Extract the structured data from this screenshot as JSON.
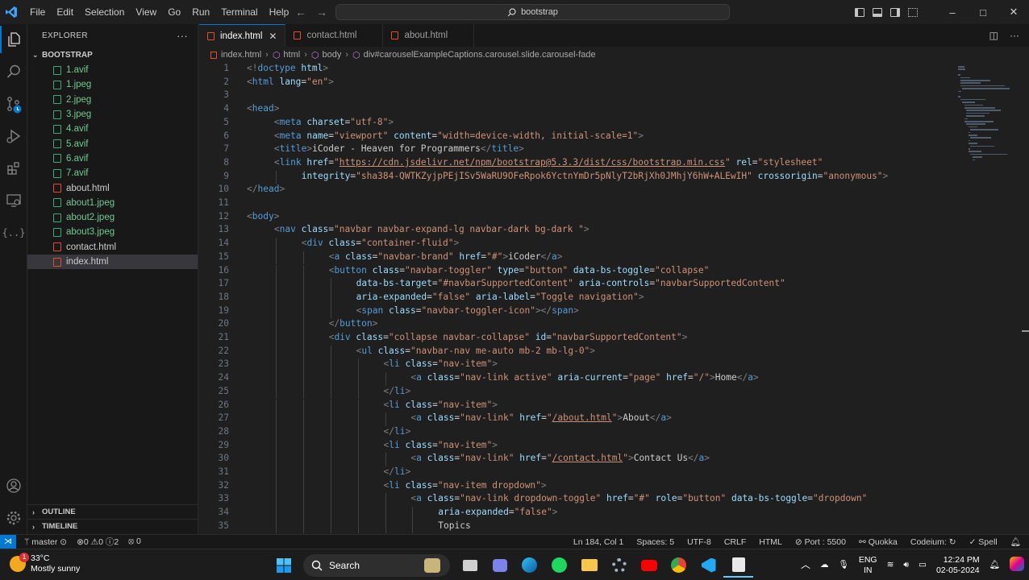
{
  "titlebar": {
    "menu": [
      "File",
      "Edit",
      "Selection",
      "View",
      "Go",
      "Run",
      "Terminal",
      "Help"
    ],
    "search": "bootstrap",
    "window_minimize": "–",
    "window_maximize": "□",
    "window_close": "✕"
  },
  "sidebar": {
    "title": "EXPLORER",
    "more": "···",
    "folder": "BOOTSTRAP",
    "files": [
      {
        "name": "1.avif",
        "kind": "img"
      },
      {
        "name": "1.jpeg",
        "kind": "img"
      },
      {
        "name": "2.jpeg",
        "kind": "img"
      },
      {
        "name": "3.jpeg",
        "kind": "img"
      },
      {
        "name": "4.avif",
        "kind": "img"
      },
      {
        "name": "5.avif",
        "kind": "img"
      },
      {
        "name": "6.avif",
        "kind": "img"
      },
      {
        "name": "7.avif",
        "kind": "img"
      },
      {
        "name": "about.html",
        "kind": "html"
      },
      {
        "name": "about1.jpeg",
        "kind": "img"
      },
      {
        "name": "about2.jpeg",
        "kind": "img"
      },
      {
        "name": "about3.jpeg",
        "kind": "img"
      },
      {
        "name": "contact.html",
        "kind": "html"
      },
      {
        "name": "index.html",
        "kind": "html",
        "selected": true
      }
    ],
    "outline": "OUTLINE",
    "timeline": "TIMELINE"
  },
  "tabs": [
    {
      "label": "index.html",
      "active": true
    },
    {
      "label": "contact.html",
      "active": false
    },
    {
      "label": "about.html",
      "active": false
    }
  ],
  "breadcrumbs": [
    "index.html",
    "html",
    "body",
    "div#carouselExampleCaptions.carousel.slide.carousel-fade"
  ],
  "editor": {
    "lines": [
      {
        "n": "1",
        "i": 0,
        "html": "<span class='p'>&lt;!</span><span class='t'>doctype</span> <span class='a'>html</span><span class='p'>&gt;</span>"
      },
      {
        "n": "2",
        "i": 0,
        "html": "<span class='p'>&lt;</span><span class='t'>html</span> <span class='a'>lang</span>=<span class='s'>\"en\"</span><span class='p'>&gt;</span>"
      },
      {
        "n": "3",
        "i": 0,
        "html": ""
      },
      {
        "n": "4",
        "i": 0,
        "html": "<span class='p'>&lt;</span><span class='t'>head</span><span class='p'>&gt;</span>"
      },
      {
        "n": "5",
        "i": 1,
        "html": "<span class='p'>&lt;</span><span class='t'>meta</span> <span class='a'>charset</span>=<span class='s'>\"utf-8\"</span><span class='p'>&gt;</span>"
      },
      {
        "n": "6",
        "i": 1,
        "html": "<span class='p'>&lt;</span><span class='t'>meta</span> <span class='a'>name</span>=<span class='s'>\"viewport\"</span> <span class='a'>content</span>=<span class='s'>\"width=device-width, initial-scale=1\"</span><span class='p'>&gt;</span>"
      },
      {
        "n": "7",
        "i": 1,
        "html": "<span class='p'>&lt;</span><span class='t'>title</span><span class='p'>&gt;</span>iCoder - Heaven for Programmers<span class='p'>&lt;/</span><span class='t'>title</span><span class='p'>&gt;</span>"
      },
      {
        "n": "8",
        "i": 1,
        "html": "<span class='p'>&lt;</span><span class='t'>link</span> <span class='a'>href</span>=<span class='s'>\"</span><span class='u'>https://cdn.jsdelivr.net/npm/bootstrap@5.3.3/dist/css/bootstrap.min.css</span><span class='s'>\"</span> <span class='a'>rel</span>=<span class='s'>\"stylesheet\"</span>"
      },
      {
        "n": "9",
        "i": 2,
        "html": "<span class='a'>integrity</span>=<span class='s'>\"sha384-QWTKZyjpPEjISv5WaRU9OFeRpok6YctnYmDr5pNlyT2bRjXh0JMhjY6hW+ALEwIH\"</span> <span class='a'>crossorigin</span>=<span class='s'>\"anonymous\"</span><span class='p'>&gt;</span>"
      },
      {
        "n": "10",
        "i": 0,
        "html": "<span class='p'>&lt;/</span><span class='t'>head</span><span class='p'>&gt;</span>"
      },
      {
        "n": "11",
        "i": 0,
        "html": ""
      },
      {
        "n": "12",
        "i": 0,
        "html": "<span class='p'>&lt;</span><span class='t'>body</span><span class='p'>&gt;</span>"
      },
      {
        "n": "13",
        "i": 1,
        "html": "<span class='p'>&lt;</span><span class='t'>nav</span> <span class='a'>class</span>=<span class='s'>\"navbar navbar-expand-lg navbar-dark bg-dark \"</span><span class='p'>&gt;</span>"
      },
      {
        "n": "14",
        "i": 2,
        "html": "<span class='p'>&lt;</span><span class='t'>div</span> <span class='a'>class</span>=<span class='s'>\"container-fluid\"</span><span class='p'>&gt;</span>"
      },
      {
        "n": "15",
        "i": 3,
        "html": "<span class='p'>&lt;</span><span class='t'>a</span> <span class='a'>class</span>=<span class='s'>\"navbar-brand\"</span> <span class='a'>href</span>=<span class='s'>\"#\"</span><span class='p'>&gt;</span>iCoder<span class='p'>&lt;/</span><span class='t'>a</span><span class='p'>&gt;</span>"
      },
      {
        "n": "16",
        "i": 3,
        "html": "<span class='p'>&lt;</span><span class='t'>button</span> <span class='a'>class</span>=<span class='s'>\"navbar-toggler\"</span> <span class='a'>type</span>=<span class='s'>\"button\"</span> <span class='a'>data-bs-toggle</span>=<span class='s'>\"collapse\"</span>"
      },
      {
        "n": "17",
        "i": 4,
        "html": "<span class='a'>data-bs-target</span>=<span class='s'>\"#navbarSupportedContent\"</span> <span class='a'>aria-controls</span>=<span class='s'>\"navbarSupportedContent\"</span>"
      },
      {
        "n": "18",
        "i": 4,
        "html": "<span class='a'>aria-expanded</span>=<span class='s'>\"false\"</span> <span class='a'>aria-label</span>=<span class='s'>\"Toggle navigation\"</span><span class='p'>&gt;</span>"
      },
      {
        "n": "19",
        "i": 4,
        "html": "<span class='p'>&lt;</span><span class='t'>span</span> <span class='a'>class</span>=<span class='s'>\"navbar-toggler-icon\"</span><span class='p'>&gt;&lt;/</span><span class='t'>span</span><span class='p'>&gt;</span>"
      },
      {
        "n": "20",
        "i": 3,
        "html": "<span class='p'>&lt;/</span><span class='t'>button</span><span class='p'>&gt;</span>"
      },
      {
        "n": "21",
        "i": 3,
        "html": "<span class='p'>&lt;</span><span class='t'>div</span> <span class='a'>class</span>=<span class='s'>\"collapse navbar-collapse\"</span> <span class='a'>id</span>=<span class='s'>\"navbarSupportedContent\"</span><span class='p'>&gt;</span>"
      },
      {
        "n": "22",
        "i": 4,
        "html": "<span class='p'>&lt;</span><span class='t'>ul</span> <span class='a'>class</span>=<span class='s'>\"navbar-nav me-auto mb-2 mb-lg-0\"</span><span class='p'>&gt;</span>"
      },
      {
        "n": "23",
        "i": 5,
        "html": "<span class='p'>&lt;</span><span class='t'>li</span> <span class='a'>class</span>=<span class='s'>\"nav-item\"</span><span class='p'>&gt;</span>"
      },
      {
        "n": "24",
        "i": 6,
        "html": "<span class='p'>&lt;</span><span class='t'>a</span> <span class='a'>class</span>=<span class='s'>\"nav-link active\"</span> <span class='a'>aria-current</span>=<span class='s'>\"page\"</span> <span class='a'>href</span>=<span class='s'>\"/\"</span><span class='p'>&gt;</span>Home<span class='p'>&lt;/</span><span class='t'>a</span><span class='p'>&gt;</span>"
      },
      {
        "n": "25",
        "i": 5,
        "html": "<span class='p'>&lt;/</span><span class='t'>li</span><span class='p'>&gt;</span>"
      },
      {
        "n": "26",
        "i": 5,
        "html": "<span class='p'>&lt;</span><span class='t'>li</span> <span class='a'>class</span>=<span class='s'>\"nav-item\"</span><span class='p'>&gt;</span>"
      },
      {
        "n": "27",
        "i": 6,
        "html": "<span class='p'>&lt;</span><span class='t'>a</span> <span class='a'>class</span>=<span class='s'>\"nav-link\"</span> <span class='a'>href</span>=<span class='s'>\"</span><span class='u'>/about.html</span><span class='s'>\"</span><span class='p'>&gt;</span>About<span class='p'>&lt;/</span><span class='t'>a</span><span class='p'>&gt;</span>"
      },
      {
        "n": "28",
        "i": 5,
        "html": "<span class='p'>&lt;/</span><span class='t'>li</span><span class='p'>&gt;</span>"
      },
      {
        "n": "29",
        "i": 5,
        "html": "<span class='p'>&lt;</span><span class='t'>li</span> <span class='a'>class</span>=<span class='s'>\"nav-item\"</span><span class='p'>&gt;</span>"
      },
      {
        "n": "30",
        "i": 6,
        "html": "<span class='p'>&lt;</span><span class='t'>a</span> <span class='a'>class</span>=<span class='s'>\"nav-link\"</span> <span class='a'>href</span>=<span class='s'>\"</span><span class='u'>/contact.html</span><span class='s'>\"</span><span class='p'>&gt;</span>Contact Us<span class='p'>&lt;/</span><span class='t'>a</span><span class='p'>&gt;</span>"
      },
      {
        "n": "31",
        "i": 5,
        "html": "<span class='p'>&lt;/</span><span class='t'>li</span><span class='p'>&gt;</span>"
      },
      {
        "n": "32",
        "i": 5,
        "html": "<span class='p'>&lt;</span><span class='t'>li</span> <span class='a'>class</span>=<span class='s'>\"nav-item dropdown\"</span><span class='p'>&gt;</span>"
      },
      {
        "n": "33",
        "i": 6,
        "html": "<span class='p'>&lt;</span><span class='t'>a</span> <span class='a'>class</span>=<span class='s'>\"nav-link dropdown-toggle\"</span> <span class='a'>href</span>=<span class='s'>\"#\"</span> <span class='a'>role</span>=<span class='s'>\"button\"</span> <span class='a'>data-bs-toggle</span>=<span class='s'>\"dropdown\"</span>"
      },
      {
        "n": "34",
        "i": 7,
        "html": "<span class='a'>aria-expanded</span>=<span class='s'>\"false\"</span><span class='p'>&gt;</span>"
      },
      {
        "n": "35",
        "i": 7,
        "html": "Topics"
      }
    ]
  },
  "statusbar": {
    "branch": "master",
    "errors": "0",
    "warnings": "0",
    "infos": "2",
    "ports": "0",
    "position": "Ln 184, Col 1",
    "spaces": "Spaces: 5",
    "encoding": "UTF-8",
    "eol": "CRLF",
    "language": "HTML",
    "port": "Port : 5500",
    "quokka": "Quokka",
    "codeium": "Codeium:",
    "spell": "Spell"
  },
  "taskbar": {
    "weather_badge": "1",
    "temperature": "33°C",
    "condition": "Mostly sunny",
    "search": "Search",
    "lang": "ENG",
    "region": "IN",
    "time": "12:24 PM",
    "date": "02-05-2024"
  },
  "colors": {
    "accent": "#0078d4",
    "html_icon": "#e44d26",
    "image_file": "#73c991"
  }
}
